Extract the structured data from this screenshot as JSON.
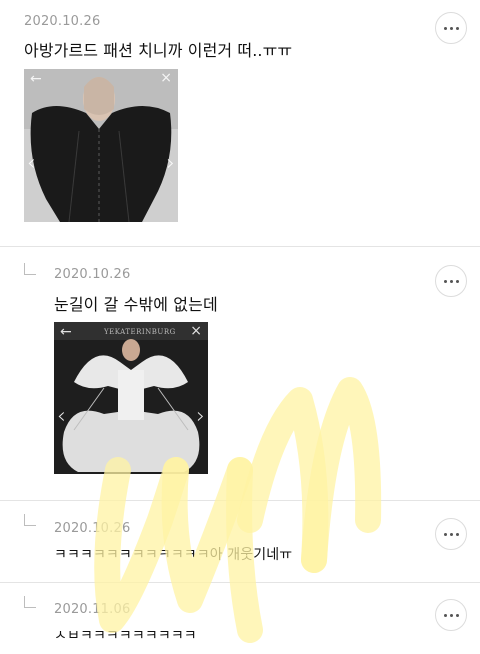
{
  "comments": [
    {
      "date": "2020.10.26",
      "text": "아방가르드 패션 치니까 이런거 떠..ㅠㅠ",
      "is_reply": false,
      "has_image": true
    },
    {
      "date": "2020.10.26",
      "text": "눈길이 갈 수밖에 없는데",
      "is_reply": true,
      "has_image": true
    },
    {
      "date": "2020.10.26",
      "text": "ㅋㅋㅋㅋㅋㅋㅋㅋㅋㅋㅋㅋ아 개웃기네ㅠ",
      "is_reply": true,
      "has_image": false
    },
    {
      "date": "2020.11.06",
      "text": "ㅅㅂㅋㅋㅋㅋㅋㅋㅋㅋㅋ",
      "is_reply": true,
      "has_image": false
    }
  ],
  "photo_nav": {
    "back": "←",
    "close": "×",
    "prev": "‹",
    "next": "›"
  },
  "photo2_caption": "YEKATERINBURG",
  "icons": {
    "more": "more-options-icon",
    "reply": "reply-indicator-icon"
  },
  "colors": {
    "date": "#9a9a9a",
    "divider": "#e4e4e4",
    "watermark": "#fff3a3"
  }
}
